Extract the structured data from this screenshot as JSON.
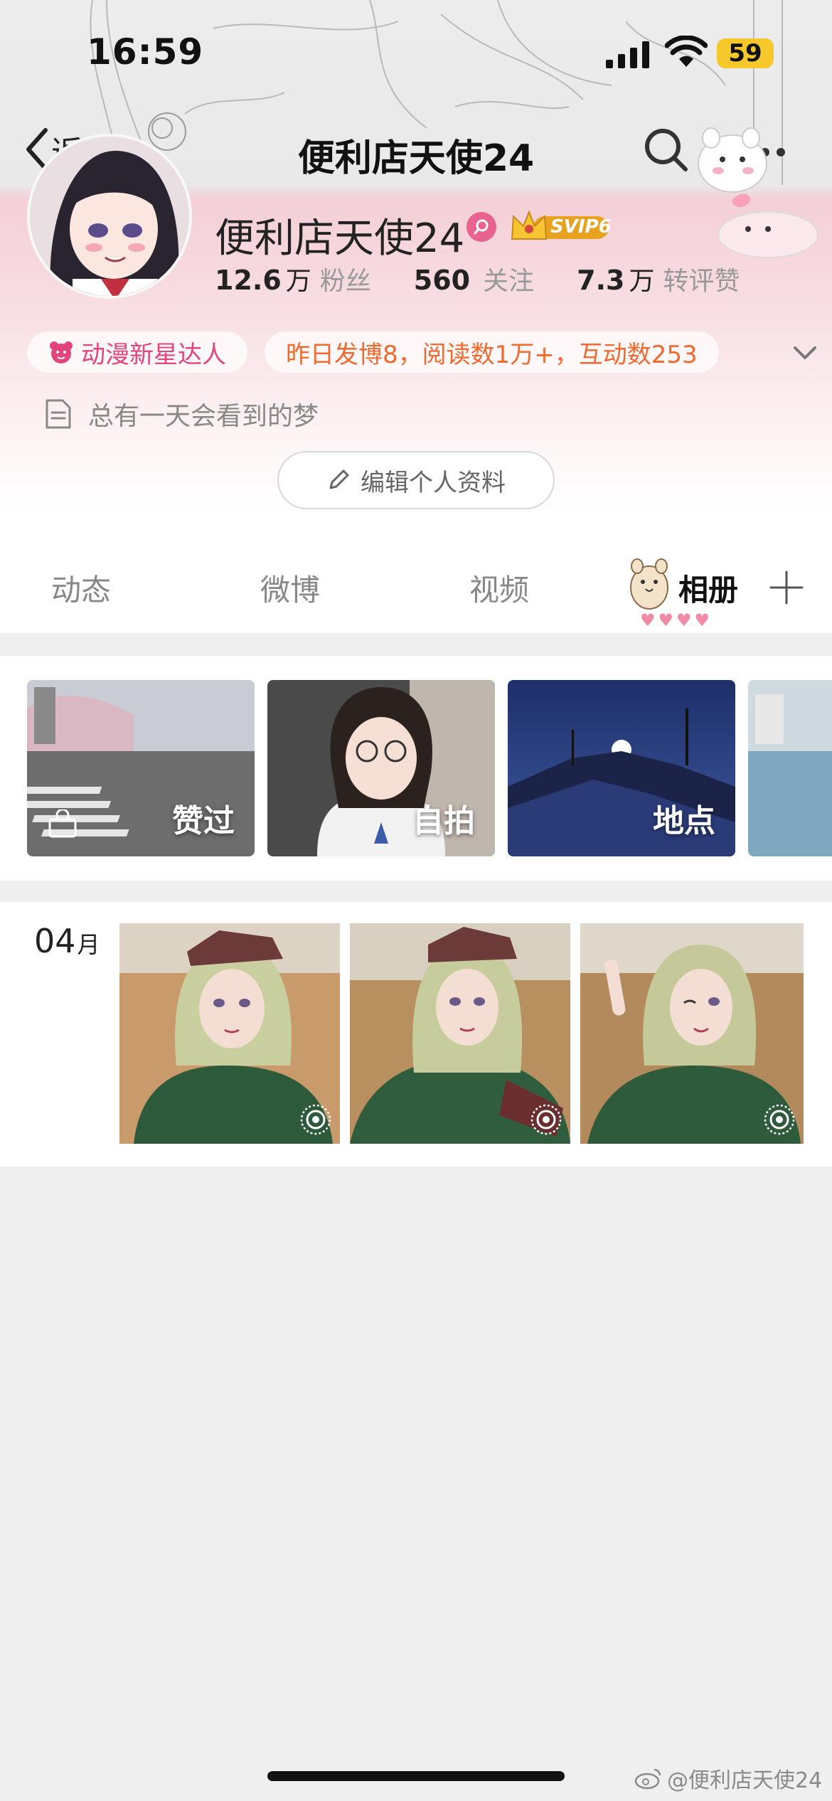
{
  "status_bar": {
    "time": "16:59",
    "battery": "59"
  },
  "nav": {
    "back_label": "返回",
    "title": "便利店天使24"
  },
  "profile": {
    "name": "便利店天使24",
    "badge": "SVIP6",
    "stats": [
      {
        "num": "12.6",
        "unit": "万",
        "label": "粉丝"
      },
      {
        "num": "560",
        "unit": "",
        "label": "关注"
      },
      {
        "num": "7.3",
        "unit": "万",
        "label": "转评赞"
      }
    ],
    "tags": [
      "动漫新星达人",
      "昨日发博8，阅读数1万+，互动数253"
    ],
    "bio": "总有一天会看到的梦",
    "edit_label": "编辑个人资料"
  },
  "tabs": [
    {
      "label": "动态",
      "active": false
    },
    {
      "label": "微博",
      "active": false
    },
    {
      "label": "视频",
      "active": false
    },
    {
      "label": "相册",
      "active": true
    }
  ],
  "albums": [
    {
      "label": "赞过"
    },
    {
      "label": "自拍"
    },
    {
      "label": "地点"
    },
    {
      "label": ""
    }
  ],
  "month_section": {
    "month": "04",
    "unit": "月"
  },
  "watermark": "@便利店天使24",
  "colors": {
    "accent_pink": "#e3447c",
    "accent_orange": "#f06a2f",
    "badge_gold": "#f6c82c"
  }
}
